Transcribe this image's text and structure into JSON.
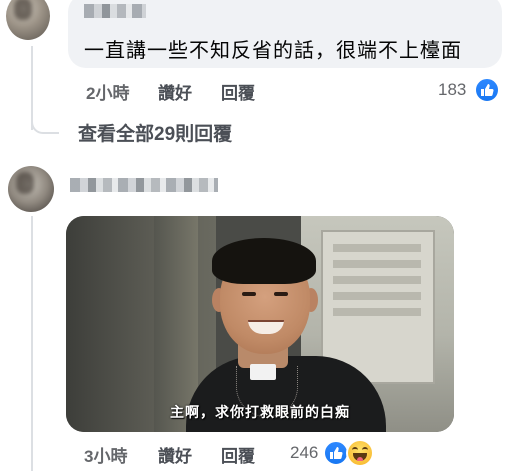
{
  "comment1": {
    "text": "一直講一些不知反省的話，很端不上檯面",
    "time": "2小時",
    "like_label": "讚好",
    "reply_label": "回覆",
    "reaction_count": "183"
  },
  "view_replies": "查看全部29則回覆",
  "comment2": {
    "image_caption": "主啊，求你打救眼前的白痴",
    "time": "3小時",
    "like_label": "讚好",
    "reply_label": "回覆",
    "reaction_count": "246"
  },
  "icons": {
    "like": "like-icon",
    "haha": "haha-reaction-icon"
  },
  "colors": {
    "bubble": "#f0f2f5",
    "meta_text": "#65676b",
    "like_blue": "#1877f2"
  }
}
